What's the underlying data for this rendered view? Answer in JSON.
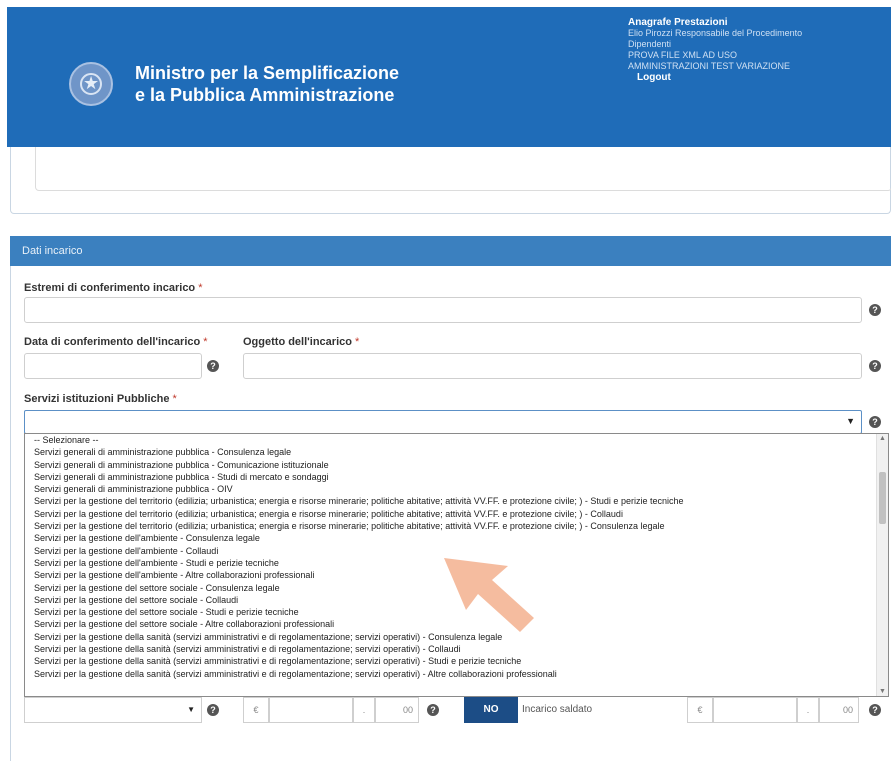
{
  "header": {
    "ministry_line1": "Ministro per la Semplificazione",
    "ministry_line2": "e la Pubblica Amministrazione",
    "user_panel": {
      "app_name": "Anagrafe Prestazioni",
      "lines": [
        "Elio Pirozzi Responsabile del Procedimento",
        "Dipendenti",
        "PROVA FILE XML AD USO",
        "AMMINISTRAZIONI TEST VARIAZIONE"
      ],
      "logout": "Logout"
    }
  },
  "section": {
    "title": "Dati incarico"
  },
  "form": {
    "estremi_label": "Estremi di conferimento incarico",
    "data_label": "Data di conferimento dell'incarico",
    "oggetto_label": "Oggetto dell'incarico",
    "servizi_label": "Servizi istituzioni Pubbliche",
    "required_mark": "*",
    "help_icon": "?"
  },
  "dropdown": {
    "options": [
      "-- Selezionare --",
      "Servizi generali di amministrazione pubblica - Consulenza legale",
      "Servizi generali di amministrazione pubblica - Comunicazione istituzionale",
      "Servizi generali di amministrazione pubblica - Studi di mercato e sondaggi",
      "Servizi generali di amministrazione pubblica - OIV",
      "Servizi per la gestione del territorio (edilizia; urbanistica; energia e risorse minerarie; politiche abitative; attività VV.FF. e protezione civile; ) - Studi e perizie tecniche",
      "Servizi per la gestione del territorio (edilizia; urbanistica; energia e risorse minerarie; politiche abitative; attività VV.FF. e protezione civile; ) - Collaudi",
      "Servizi per la gestione del territorio (edilizia; urbanistica; energia e risorse minerarie; politiche abitative; attività VV.FF. e protezione civile; ) - Consulenza legale",
      "Servizi per la gestione dell'ambiente - Consulenza legale",
      "Servizi per la gestione dell'ambiente - Collaudi",
      "Servizi per la gestione dell'ambiente - Studi e perizie tecniche",
      "Servizi per la gestione dell'ambiente - Altre collaborazioni professionali",
      "Servizi per la gestione del settore sociale - Consulenza legale",
      "Servizi per la gestione del settore sociale - Collaudi",
      "Servizi per la gestione del settore sociale - Studi e perizie tecniche",
      "Servizi per la gestione del settore sociale - Altre collaborazioni professionali",
      "Servizi per la gestione della sanità (servizi amministrativi e di regolamentazione; servizi operativi) - Consulenza legale",
      "Servizi per la gestione della sanità (servizi amministrativi e di regolamentazione; servizi operativi) - Collaudi",
      "Servizi per la gestione della sanità (servizi amministrativi e di regolamentazione; servizi operativi) - Studi e perizie tecniche",
      "Servizi per la gestione della sanità (servizi amministrativi e di regolamentazione; servizi operativi) - Altre collaborazioni professionali"
    ]
  },
  "bottom": {
    "currency": "€",
    "decimals": "00",
    "no_button": "NO",
    "saldato_label": "Incarico saldato"
  },
  "colors": {
    "header_blue": "#1f6cb8",
    "section_blue": "#3b80bf",
    "arrow": "#f4b89a"
  }
}
